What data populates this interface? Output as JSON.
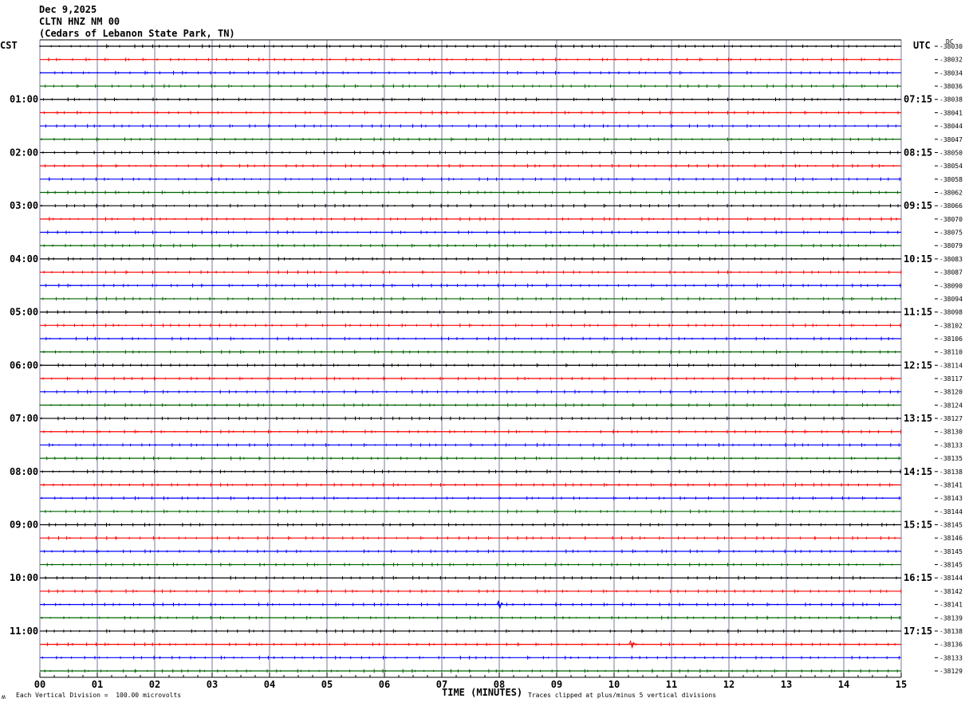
{
  "header": {
    "date": "Dec 9,2025",
    "station": "CLTN HNZ NM 00",
    "location": "(Cedars of Lebanon State Park, TN)"
  },
  "left_timezone": "CST",
  "right_timezone": "UTC",
  "dc_label": "DC",
  "footer": {
    "scale_note": "Each Vertical Division =  100.00 microvolts",
    "clip_note": "Traces clipped at plus/minus 5 vertical divisions",
    "xlabel": "TIME (MINUTES)",
    "logo_mark": "ʍ"
  },
  "colors": {
    "trace_cycle": [
      "#000000",
      "#ff0000",
      "#0000ff",
      "#006400"
    ],
    "grid_vertical": "#7a7a9a",
    "grid_border": "#000000"
  },
  "chart_data": {
    "type": "line",
    "subtype": "helicorder",
    "x_range": [
      0,
      15
    ],
    "x_ticks": [
      "00",
      "01",
      "02",
      "03",
      "04",
      "05",
      "06",
      "07",
      "08",
      "09",
      "10",
      "11",
      "12",
      "13",
      "14",
      "15"
    ],
    "line_minutes": 15,
    "left_hour_labels": [
      "01:00",
      "02:00",
      "03:00",
      "04:00",
      "05:00",
      "06:00",
      "07:00",
      "08:00",
      "09:00",
      "10:00",
      "11:00"
    ],
    "right_hour_labels": [
      "07:15",
      "08:15",
      "09:15",
      "10:15",
      "11:15",
      "12:15",
      "13:15",
      "14:15",
      "15:15",
      "16:15",
      "17:15"
    ],
    "dc_offsets": [
      "-38030",
      "-38032",
      "-38034",
      "-38036",
      "-38038",
      "-38041",
      "-38044",
      "-38047",
      "-38050",
      "-38054",
      "-38058",
      "-38062",
      "-38066",
      "-38070",
      "-38075",
      "-38079",
      "-38083",
      "-38087",
      "-38090",
      "-38094",
      "-38098",
      "-38102",
      "-38106",
      "-38110",
      "-38114",
      "-38117",
      "-38120",
      "-38124",
      "-38127",
      "-38130",
      "-38133",
      "-38135",
      "-38138",
      "-38141",
      "-38143",
      "-38144",
      "-38145",
      "-38146",
      "-38145",
      "-38145",
      "-38144",
      "-38142",
      "-38141",
      "-38139",
      "-38138",
      "-38136",
      "-38133",
      "-38129"
    ],
    "events": [
      {
        "line_index": 42,
        "minute": 8.0,
        "description": "small transient on blue trace"
      },
      {
        "line_index": 45,
        "minute": 10.3,
        "description": "small transient on red trace"
      }
    ]
  }
}
